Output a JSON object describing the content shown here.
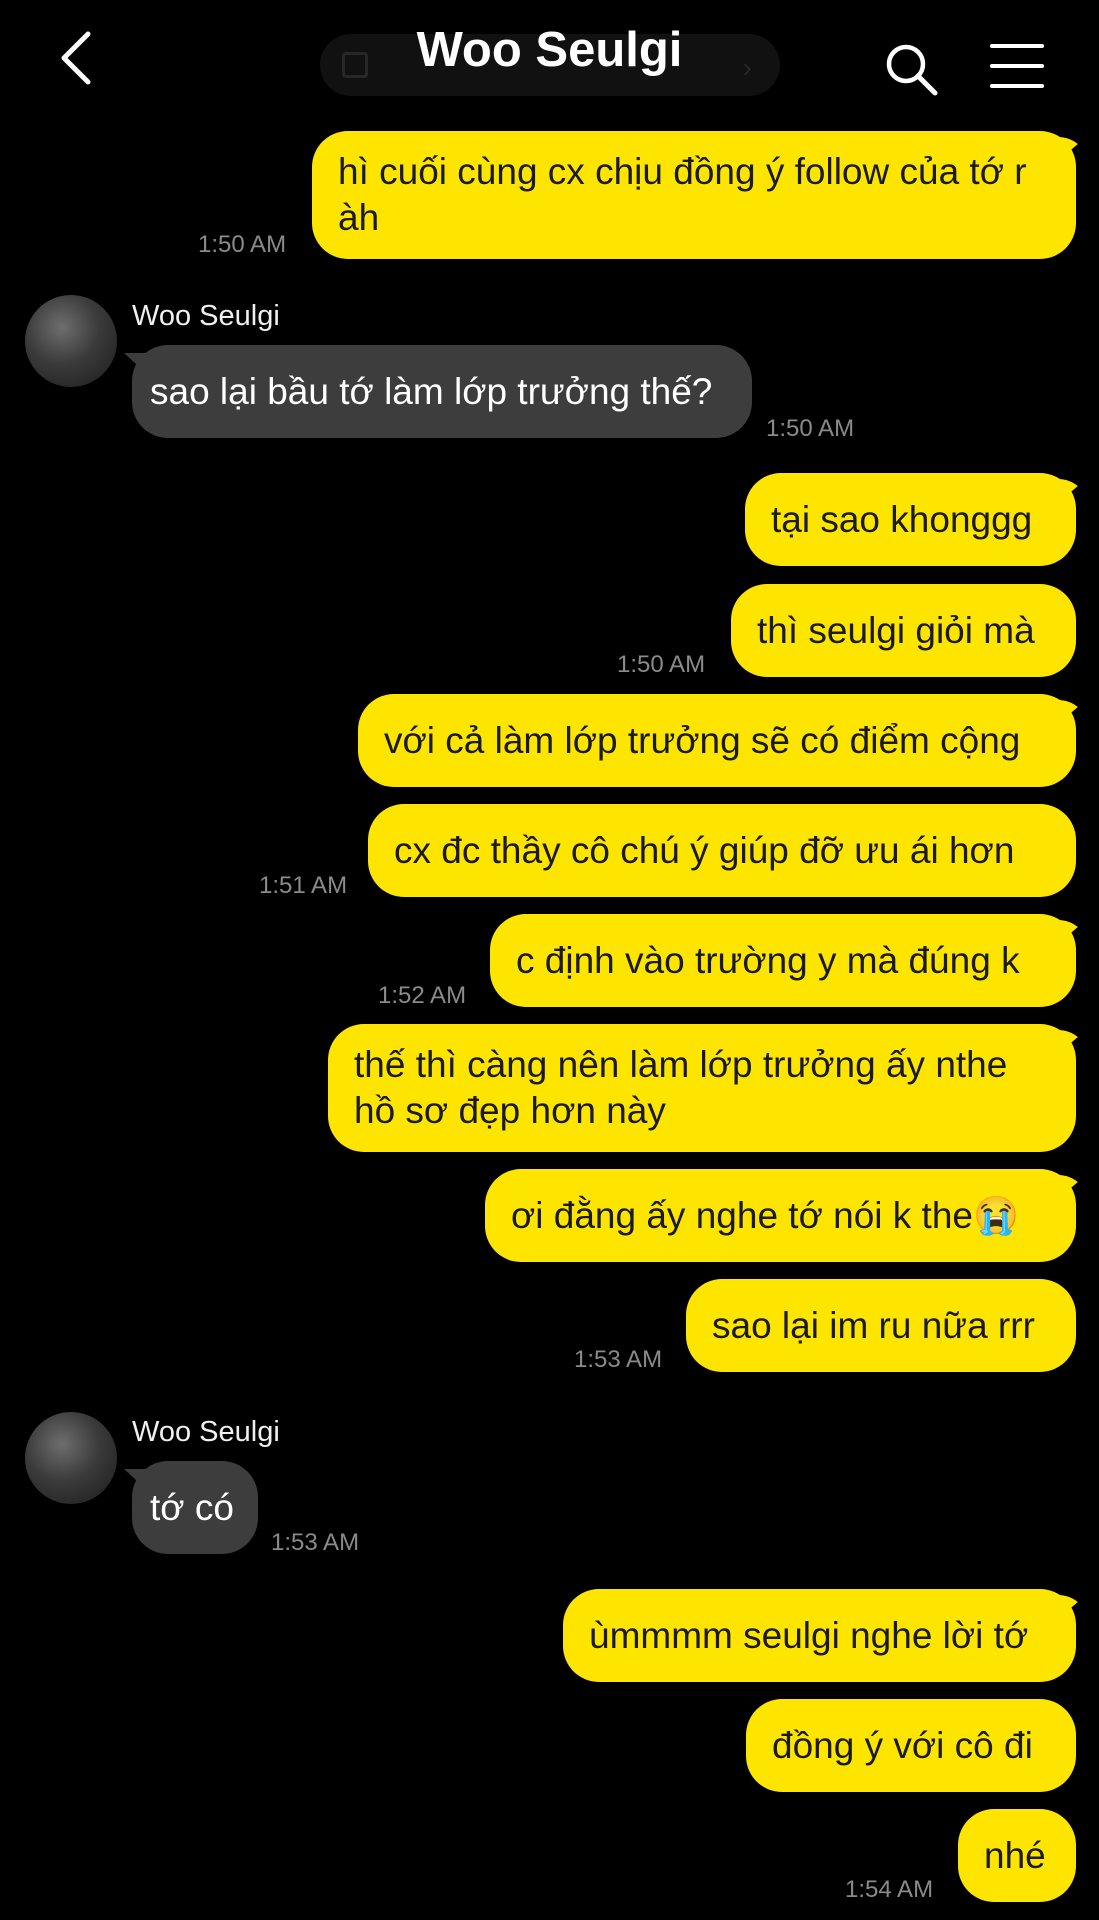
{
  "header": {
    "title": "Woo Seulgi",
    "back_icon": "chevron-left-icon",
    "search_icon": "search-icon",
    "menu_icon": "hamburger-menu-icon"
  },
  "colors": {
    "my_bubble": "#fee500",
    "their_bubble": "#3d3d3d",
    "background": "#000000",
    "timestamp": "#8a8a8a"
  },
  "messages": [
    {
      "sender": "me",
      "text": "hì cuối cùng cx chịu đồng ý follow của tớ r àh",
      "time": "1:50 AM"
    },
    {
      "sender": "them",
      "name": "Woo Seulgi",
      "text": "sao lại bầu tớ làm lớp trưởng thế?",
      "time": "1:50 AM"
    },
    {
      "sender": "me",
      "text": "tại sao khonggg",
      "time": ""
    },
    {
      "sender": "me",
      "text": "thì seulgi giỏi mà",
      "time": "1:50 AM"
    },
    {
      "sender": "me",
      "text": "với cả làm lớp trưởng sẽ có điểm cộng",
      "time": ""
    },
    {
      "sender": "me",
      "text": "cx đc thầy cô chú ý giúp đỡ ưu ái hơn",
      "time": "1:51 AM"
    },
    {
      "sender": "me",
      "text": "c định vào trường y mà đúng k",
      "time": "1:52 AM"
    },
    {
      "sender": "me",
      "text": "thế thì càng nên làm lớp trưởng ấy nthe hồ sơ đẹp hơn này",
      "time": ""
    },
    {
      "sender": "me",
      "text": "ơi đằng ấy nghe tớ nói k the😭",
      "time": ""
    },
    {
      "sender": "me",
      "text": "sao lại im ru nữa rrr",
      "time": "1:53 AM"
    },
    {
      "sender": "them",
      "name": "Woo Seulgi",
      "text": "tớ có",
      "time": "1:53 AM"
    },
    {
      "sender": "me",
      "text": "ùmmmm seulgi nghe lời tớ",
      "time": ""
    },
    {
      "sender": "me",
      "text": "đồng ý với cô đi",
      "time": ""
    },
    {
      "sender": "me",
      "text": "nhé",
      "time": "1:54 AM"
    }
  ]
}
